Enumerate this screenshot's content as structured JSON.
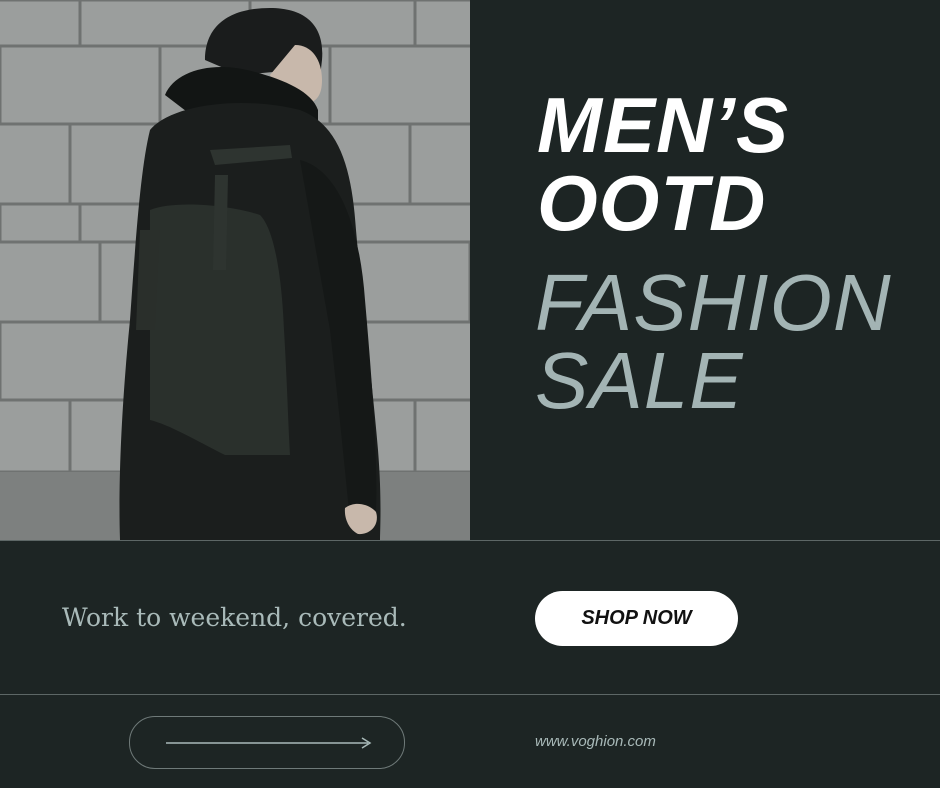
{
  "headline": {
    "line1": "MEN’S",
    "line2": "OOTD",
    "line3": "FASHION",
    "line4": "SALE"
  },
  "tagline": "Work to weekend, covered.",
  "cta": {
    "label": "SHOP NOW"
  },
  "footer": {
    "website": "www.voghion.com",
    "arrow_icon": "right-arrow-icon"
  },
  "colors": {
    "background": "#1d2524",
    "headline_primary": "#ffffff",
    "headline_accent": "#a3b4b4",
    "button_bg": "#ffffff",
    "button_text": "#111111"
  }
}
